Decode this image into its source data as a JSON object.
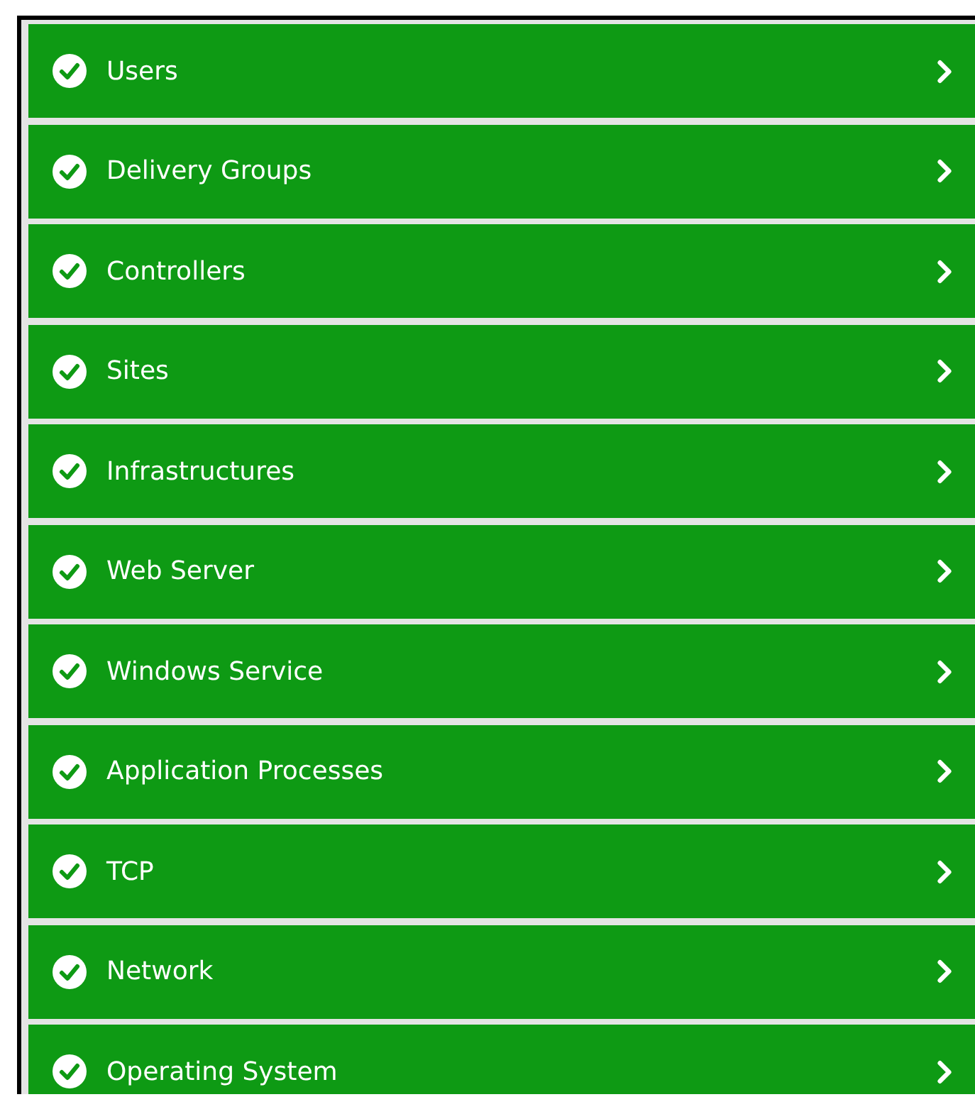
{
  "items": [
    {
      "label": "Users",
      "kind": "ok"
    },
    {
      "label": "Delivery Groups",
      "kind": "ok"
    },
    {
      "label": "Controllers",
      "kind": "ok"
    },
    {
      "label": "Sites",
      "kind": "ok"
    },
    {
      "label": "Infrastructures",
      "kind": "ok"
    },
    {
      "label": "Web Server",
      "kind": "ok"
    },
    {
      "label": "Windows Service",
      "kind": "ok"
    },
    {
      "label": "Application Processes",
      "kind": "ok"
    },
    {
      "label": "TCP",
      "kind": "ok"
    },
    {
      "label": "Network",
      "kind": "ok"
    },
    {
      "label": "Operating System",
      "kind": "ok"
    }
  ]
}
